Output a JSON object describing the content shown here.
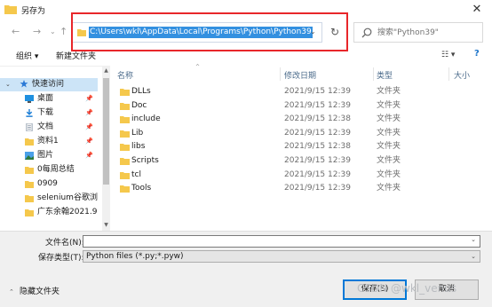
{
  "window": {
    "title": "另存为"
  },
  "nav_buttons": {
    "back": "←",
    "forward": "→",
    "dropdown": "⌄",
    "up": "↑"
  },
  "address": {
    "path": "C:\\Users\\wkl\\AppData\\Local\\Programs\\Python\\Python39",
    "dropdown": "⌄",
    "refresh": "↻"
  },
  "search": {
    "placeholder": "搜索\"Python39\""
  },
  "toolbar": {
    "organize": "组织 ▾",
    "new_folder": "新建文件夹",
    "view": "☷ ▾",
    "help": "?"
  },
  "sidebar": {
    "items": [
      {
        "label": "快速访问",
        "icon": "star-icon",
        "pinned": false,
        "selected": true
      },
      {
        "label": "桌面",
        "icon": "desktop-icon",
        "pinned": true
      },
      {
        "label": "下载",
        "icon": "download-icon",
        "pinned": true
      },
      {
        "label": "文档",
        "icon": "document-icon",
        "pinned": true
      },
      {
        "label": "资料1",
        "icon": "folder-icon",
        "pinned": true
      },
      {
        "label": "图片",
        "icon": "pictures-icon",
        "pinned": true
      },
      {
        "label": "0每周总结",
        "icon": "folder-icon",
        "pinned": false
      },
      {
        "label": "0909",
        "icon": "folder-icon",
        "pinned": false
      },
      {
        "label": "selenium谷歌浏",
        "icon": "folder-icon",
        "pinned": false
      },
      {
        "label": "广东余翰2021.9",
        "icon": "folder-icon",
        "pinned": false
      }
    ],
    "pin_glyph": "📌"
  },
  "columns": {
    "name": "名称",
    "modified": "修改日期",
    "type": "类型",
    "size": "大小"
  },
  "files": [
    {
      "name": "DLLs",
      "modified": "2021/9/15 12:39",
      "type": "文件夹"
    },
    {
      "name": "Doc",
      "modified": "2021/9/15 12:39",
      "type": "文件夹"
    },
    {
      "name": "include",
      "modified": "2021/9/15 12:38",
      "type": "文件夹"
    },
    {
      "name": "Lib",
      "modified": "2021/9/15 12:39",
      "type": "文件夹"
    },
    {
      "name": "libs",
      "modified": "2021/9/15 12:38",
      "type": "文件夹"
    },
    {
      "name": "Scripts",
      "modified": "2021/9/15 12:39",
      "type": "文件夹"
    },
    {
      "name": "tcl",
      "modified": "2021/9/15 12:39",
      "type": "文件夹"
    },
    {
      "name": "Tools",
      "modified": "2021/9/15 12:39",
      "type": "文件夹"
    }
  ],
  "bottom": {
    "filename_label": "文件名(N):",
    "filename_value": "",
    "filetype_label": "保存类型(T):",
    "filetype_value": "Python files (*.py;*.pyw)",
    "hide_folders": "隐藏文件夹",
    "save": "保存(S)",
    "cancel": "取消"
  },
  "watermark": "CSDN @wkl_venus",
  "colors": {
    "selection": "#3390e0",
    "highlight_box": "#e8262a",
    "folder": "#f5c84c",
    "sidebar_selected": "#cce4f7",
    "primary_border": "#0078d7"
  }
}
